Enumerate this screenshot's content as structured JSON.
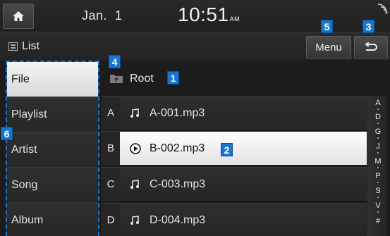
{
  "status": {
    "date": "Jan.  1",
    "time": "10:51",
    "ampm": "AM"
  },
  "header": {
    "title": "List",
    "menu_label": "Menu"
  },
  "callouts": {
    "path": "1",
    "playing": "2",
    "back": "3",
    "folder": "4",
    "menu": "5",
    "categories": "6"
  },
  "categories": [
    {
      "label": "File",
      "selected": true
    },
    {
      "label": "Playlist"
    },
    {
      "label": "Artist"
    },
    {
      "label": "Song"
    },
    {
      "label": "Album"
    }
  ],
  "path": "Root",
  "files": [
    {
      "letter": "A",
      "name": "A-001.mp3",
      "playing": false
    },
    {
      "letter": "B",
      "name": "B-002.mp3",
      "playing": true
    },
    {
      "letter": "C",
      "name": "C-003.mp3",
      "playing": false
    },
    {
      "letter": "D",
      "name": "D-004.mp3",
      "playing": false
    }
  ],
  "alphabet": [
    "A",
    "D",
    "G",
    "J",
    "M",
    "P",
    "S",
    "V",
    "#"
  ],
  "colors": {
    "callout": "#1677d2",
    "selected_row": "#f0f0f0",
    "background": "#1c1c1c"
  }
}
